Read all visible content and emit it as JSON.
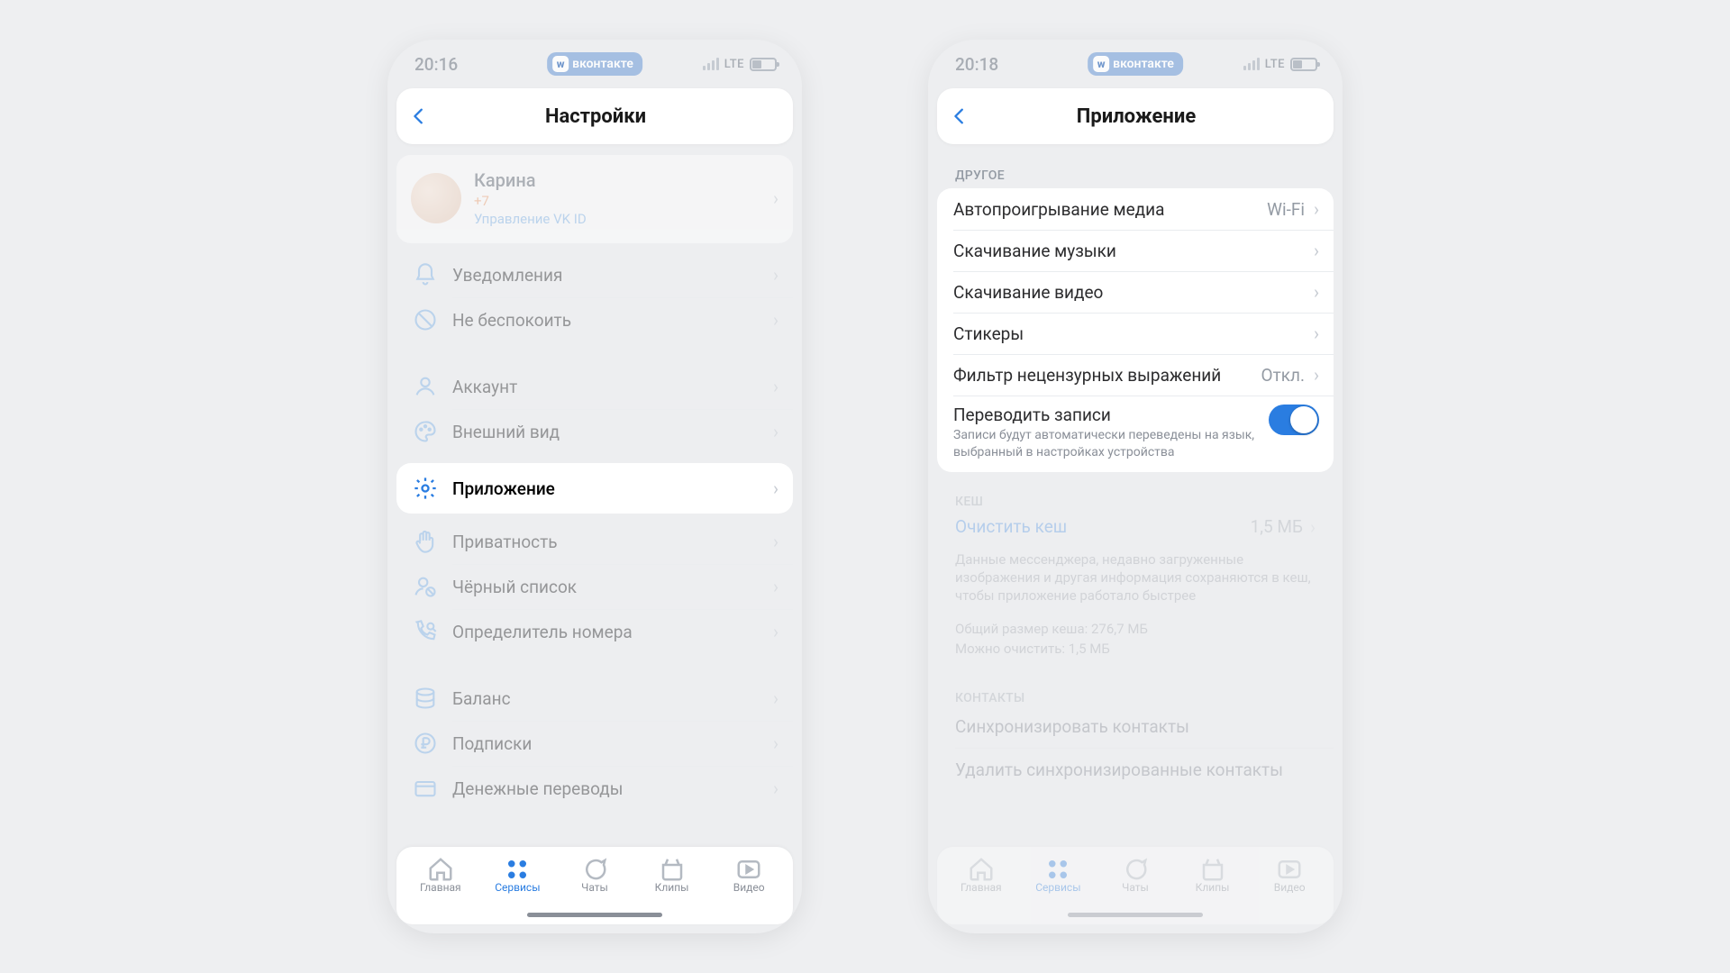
{
  "left": {
    "time": "20:16",
    "vk_brand": "вконтакте",
    "lte": "LTE",
    "header": "Настройки",
    "profile": {
      "name": "Карина",
      "phone": "+7",
      "manage": "Управление VK ID"
    },
    "rows": {
      "notifications": "Уведомления",
      "dnd": "Не беспокоить",
      "account": "Аккаунт",
      "appearance": "Внешний вид",
      "app": "Приложение",
      "privacy": "Приватность",
      "blacklist": "Чёрный список",
      "callerid": "Определитель номера",
      "balance": "Баланс",
      "subs": "Подписки",
      "transfers": "Денежные переводы"
    },
    "nav": {
      "home": "Главная",
      "services": "Сервисы",
      "chats": "Чаты",
      "clips": "Клипы",
      "video": "Видео"
    }
  },
  "right": {
    "time": "20:18",
    "vk_brand": "вконтакте",
    "lte": "LTE",
    "header": "Приложение",
    "section_other": "ДРУГОЕ",
    "rows": {
      "autoplay": "Автопроигрывание медиа",
      "autoplay_val": "Wi-Fi",
      "music": "Скачивание музыки",
      "video": "Скачивание видео",
      "stickers": "Стикеры",
      "profanity": "Фильтр нецензурных выражений",
      "profanity_val": "Откл.",
      "translate": "Переводить записи",
      "translate_sub": "Записи будут автоматически переведены на язык, выбранный в настройках устройства"
    },
    "section_cache": "КЕШ",
    "cache": {
      "clear": "Очистить кеш",
      "clear_val": "1,5 МБ",
      "note": "Данные мессенджера, недавно загруженные изображения и другая информация сохраняются в кеш, чтобы приложение работало быстрее",
      "total": "Общий размер кеша: 276,7 МБ",
      "canclear": "Можно очистить: 1,5 МБ"
    },
    "section_contacts": "КОНТАКТЫ",
    "contacts": {
      "sync": "Синхронизировать контакты",
      "delete": "Удалить синхронизированные контакты"
    },
    "nav": {
      "home": "Главная",
      "services": "Сервисы",
      "chats": "Чаты",
      "clips": "Клипы",
      "video": "Видео"
    }
  }
}
